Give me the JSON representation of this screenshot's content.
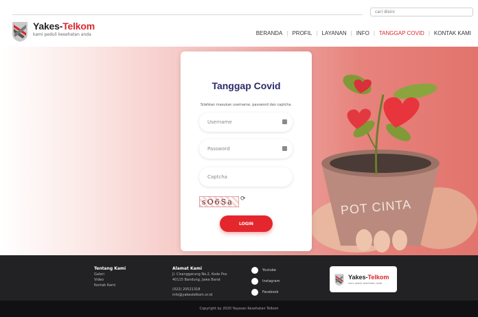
{
  "header": {
    "search_placeholder": "cari disini",
    "brand_main": "Yakes-",
    "brand_accent": "Telkom",
    "tagline": "kami peduli kesehatan anda",
    "nav": [
      {
        "label": "BERANDA",
        "active": false
      },
      {
        "label": "PROFIL",
        "active": false
      },
      {
        "label": "LAYANAN",
        "active": false
      },
      {
        "label": "INFO",
        "active": false
      },
      {
        "label": "TANGGAP COVID",
        "active": true
      },
      {
        "label": "KONTAK KAMI",
        "active": false
      }
    ],
    "accent_color": "#d9262c"
  },
  "hero": {
    "pot_text": "POT CINTA"
  },
  "login": {
    "title": "Tanggap Covid",
    "subtitle": "Silahkan masukan username, password dan captcha.",
    "username_placeholder": "Username",
    "password_placeholder": "Password",
    "captcha_placeholder": "Captcha",
    "captcha_text": "sO6Sa",
    "button_label": "LOGIN",
    "button_color": "#e4272d"
  },
  "footer": {
    "about": {
      "heading": "Tentang Kami",
      "links": [
        "Galeri",
        "Video",
        "Kontak Kami"
      ]
    },
    "address": {
      "heading": "Alamat Kami",
      "line1": "Jl. Cisanggarung No.2, Kode Pos",
      "line2": "40115 Bandung, Jawa Barat",
      "phone": "(022) 20521318",
      "email": "info@yakestelkom.or.id"
    },
    "social": [
      {
        "label": "Youtube",
        "icon": "youtube-icon"
      },
      {
        "label": "Instagram",
        "icon": "instagram-icon"
      },
      {
        "label": "Facebook",
        "icon": "facebook-icon"
      }
    ],
    "logo_main": "Yakes-",
    "logo_accent": "Telkom",
    "logo_tagline": "kami peduli kesehatan anda",
    "copyright": "Copyright by 2020 Yayasan Kesehatan Telkom"
  }
}
